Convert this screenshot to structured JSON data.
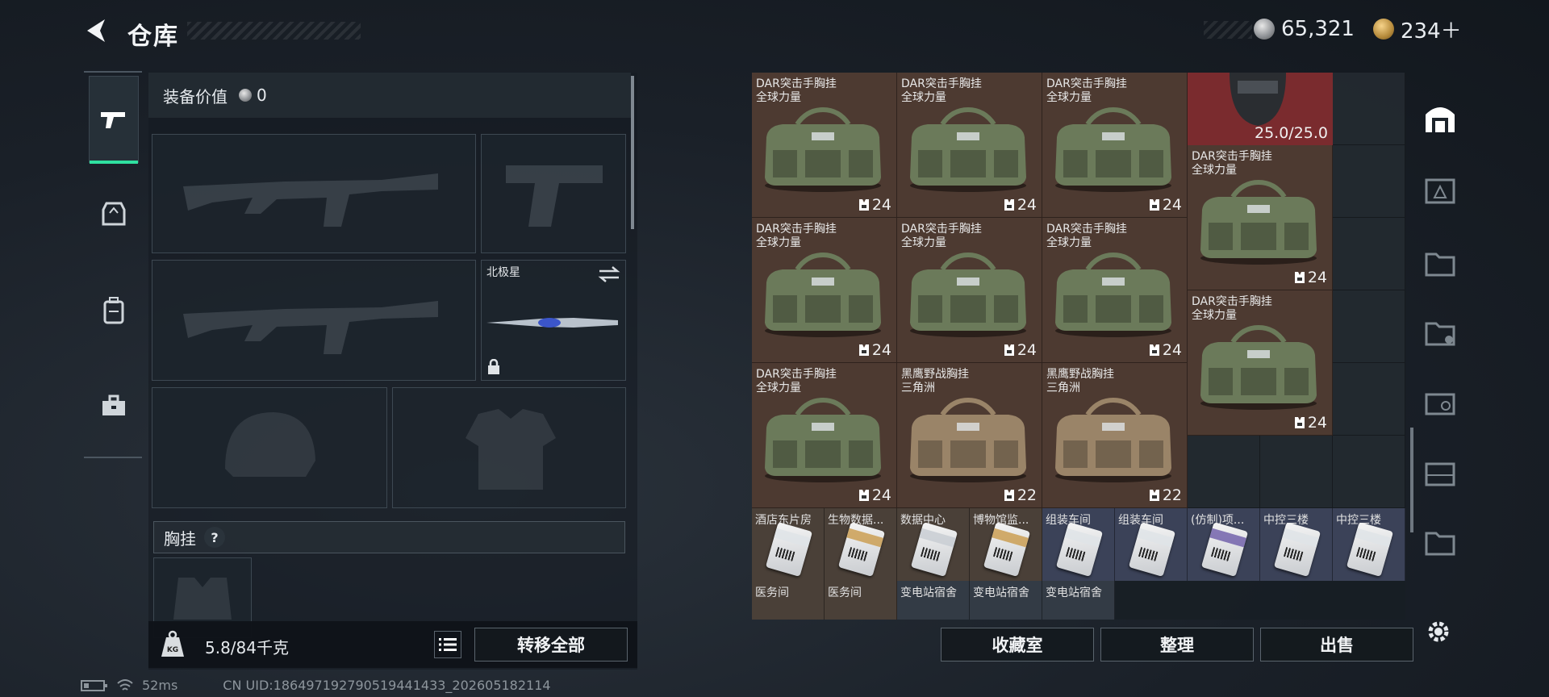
{
  "header": {
    "title": "仓库",
    "silver": "65,321",
    "gold": "234＋"
  },
  "left_tabs": [
    "weapon-tab",
    "armor-tab",
    "backpack-tab",
    "toolbox-tab"
  ],
  "loadout": {
    "value_label": "装备价值",
    "value": "0",
    "melee_name": "北极星",
    "chest_label": "胸挂",
    "help": "?",
    "weight": "5.8/84千克",
    "weight_icon_text": "KG",
    "transfer_all": "转移全部"
  },
  "stash": {
    "vests": [
      {
        "name": "DAR突击手胸挂",
        "sub": "全球力量",
        "count": "24"
      },
      {
        "name": "DAR突击手胸挂",
        "sub": "全球力量",
        "count": "24"
      },
      {
        "name": "DAR突击手胸挂",
        "sub": "全球力量",
        "count": "24"
      },
      {
        "name": "DAR突击手胸挂",
        "sub": "全球力量",
        "count": "24"
      },
      {
        "name": "DAR突击手胸挂",
        "sub": "全球力量",
        "count": "24"
      },
      {
        "name": "DAR突击手胸挂",
        "sub": "全球力量",
        "count": "24"
      },
      {
        "name": "DAR突击手胸挂",
        "sub": "全球力量",
        "count": "24"
      },
      {
        "name": "黑鹰野战胸挂",
        "sub": "三角洲",
        "count": "22"
      },
      {
        "name": "黑鹰野战胸挂",
        "sub": "三角洲",
        "count": "22"
      },
      {
        "name": "DAR突击手胸挂",
        "sub": "全球力量",
        "count": "24"
      },
      {
        "name": "DAR突击手胸挂",
        "sub": "全球力量",
        "count": "24"
      }
    ],
    "helmet_durability": "25.0/25.0",
    "keys_row1": [
      "酒店东片房",
      "生物数据...",
      "数据中心",
      "博物馆监...",
      "组装车间",
      "组装车间",
      "(仿制)项...",
      "中控三楼",
      "中控三楼"
    ],
    "keys_row2": [
      "医务间",
      "医务间",
      "变电站宿舍",
      "变电站宿舍",
      "变电站宿舍"
    ]
  },
  "actions": {
    "collection": "收藏室",
    "sort": "整理",
    "sell": "出售"
  },
  "status": {
    "ping": "52ms",
    "uid": "CN UID:1864971927905194414​33_202605182114"
  },
  "colors": {
    "accent": "#2fe0a0",
    "vest_cell": "#4d3a31",
    "helmet_cell": "#7a2b2e"
  }
}
